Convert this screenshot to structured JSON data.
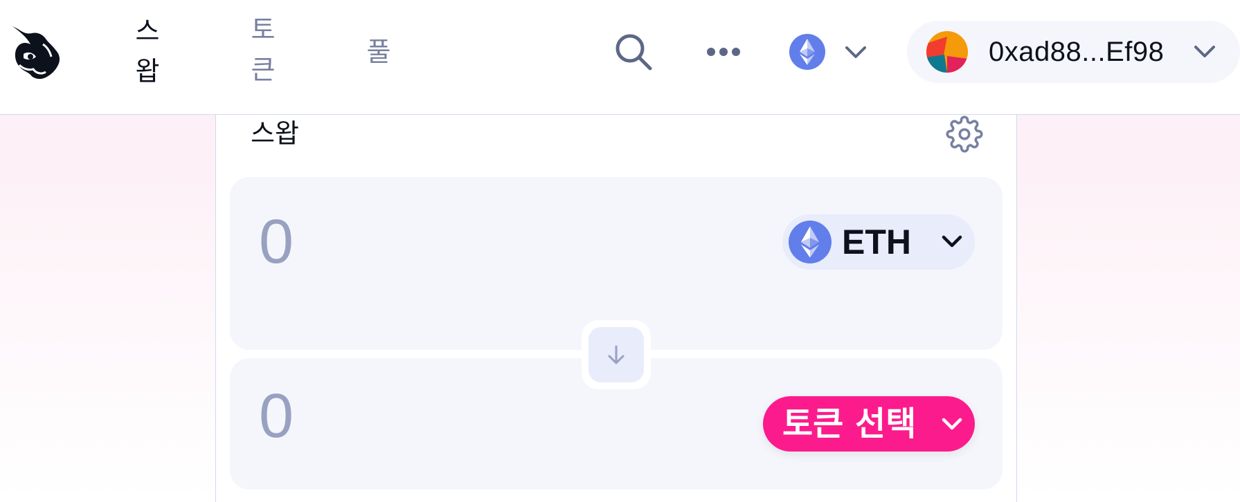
{
  "nav": {
    "items": [
      {
        "label": "스왑",
        "active": true
      },
      {
        "label": "토큰",
        "active": false
      },
      {
        "label": "풀",
        "active": false
      }
    ]
  },
  "header": {
    "icons": [
      "unicorn-logo-icon",
      "search-icon",
      "more-icon",
      "ethereum-icon",
      "chevron-down-icon"
    ],
    "wallet_address": "0xad88...Ef98"
  },
  "swap": {
    "title": "스왑",
    "input": {
      "amount": "0",
      "token": "ETH"
    },
    "output": {
      "amount": "0",
      "select_label": "토큰 선택"
    }
  },
  "colors": {
    "accent": "#fc1b8c",
    "eth": "#627eea",
    "muted_text": "#98a1c0",
    "panel_bg": "#f5f6fc"
  }
}
